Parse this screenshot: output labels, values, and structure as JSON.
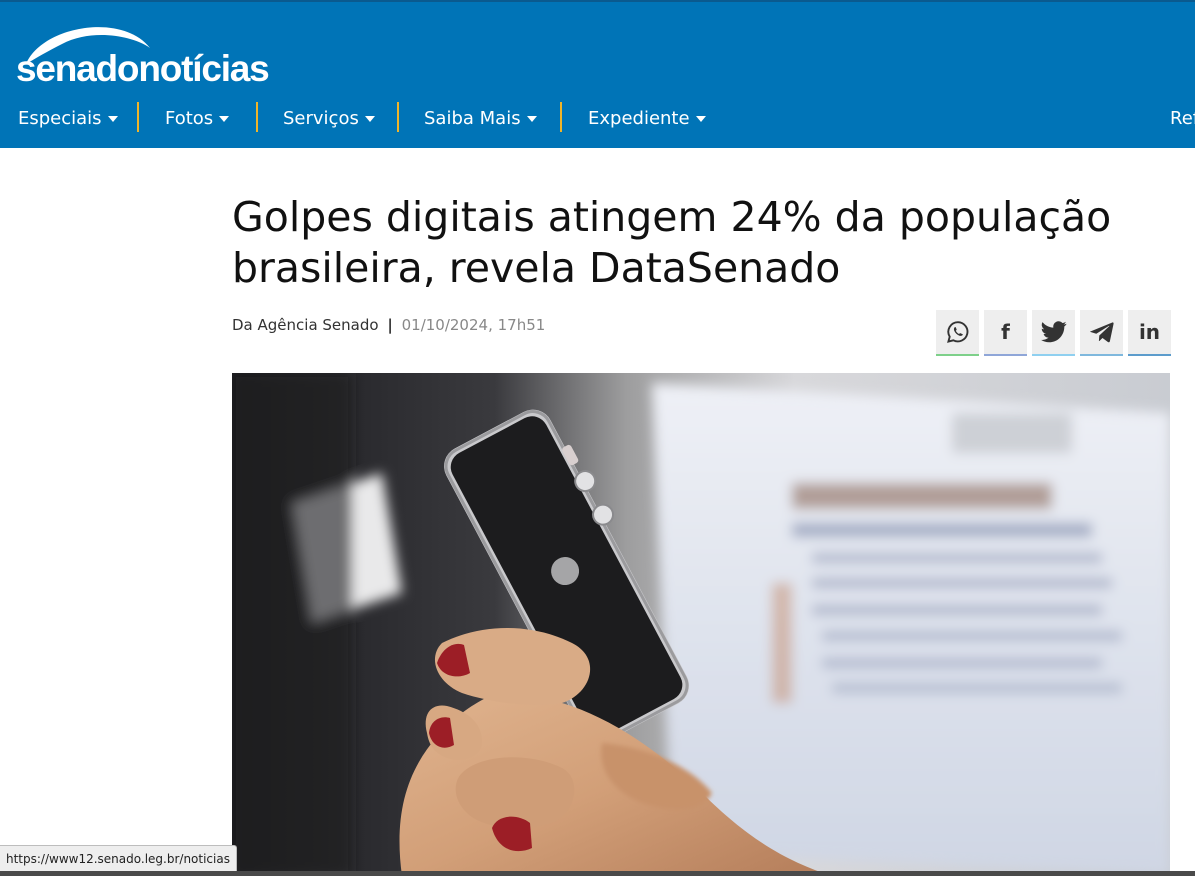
{
  "site": {
    "logo_part1": "senado",
    "logo_part2": "notícias",
    "brand_color": "#0074b7",
    "separator_color": "#f0b429"
  },
  "nav": {
    "items": [
      {
        "label": "Especiais"
      },
      {
        "label": "Fotos"
      },
      {
        "label": "Serviços"
      },
      {
        "label": "Saiba Mais"
      },
      {
        "label": "Expediente"
      }
    ],
    "cut_off_item": "Ref"
  },
  "article": {
    "title": "Golpes digitais atingem 24% da população brasileira, revela DataSenado",
    "source": "Da Agência Senado",
    "separator": "|",
    "date": "01/10/2024, 17h51"
  },
  "share": {
    "buttons": [
      "whatsapp-icon",
      "facebook-icon",
      "twitter-icon",
      "telegram-icon",
      "linkedin-icon"
    ],
    "linkedin_text": "in",
    "facebook_text": "f"
  },
  "status_bar": {
    "url": "https://www12.senado.leg.br/noticias"
  }
}
